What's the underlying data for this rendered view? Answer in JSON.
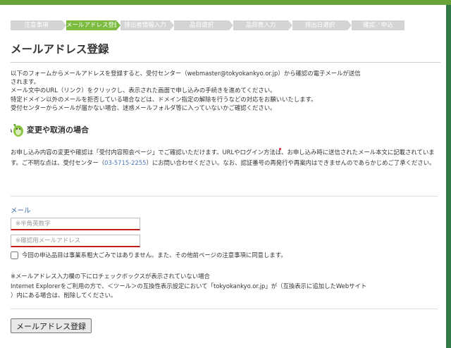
{
  "steps": [
    {
      "label": "注意事項",
      "active": false
    },
    {
      "label": "メールアドレス登録",
      "active": true
    },
    {
      "label": "排出者情報入力",
      "active": false
    },
    {
      "label": "品目選択",
      "active": false
    },
    {
      "label": "品目数入力",
      "active": false
    },
    {
      "label": "排出日選択",
      "active": false
    },
    {
      "label": "確認／申込",
      "active": false
    }
  ],
  "page": {
    "title": "メールアドレス登録"
  },
  "intro": {
    "line1": "以下のフォームからメールアドレスを登録すると、受付センター（webmaster@tokyokankyo.or.jp）から確認の電子メールが送信",
    "line2": "されます。",
    "line3": "メール文中のURL（リンク）をクリックし、表示された画面で申し込みの手続きを進めてください。",
    "line4": "特定ドメイン以外のメールを拒否している場合などは、ドメイン指定の解除を行うなどの対応をお願いいたします。",
    "line5": "受付センターからメールが届かない場合、迷惑メールフォルダ等に入っていないかご確認ください。"
  },
  "change": {
    "heading": "変更や取消の場合",
    "text_before": "お申し込み内容の変更や確認は「受付内容照会ページ」でご確認いただけます。URLやログイン方法は、お申し込み時に送信されたメール本文に記載されています。ご不明な点は、受付センター（",
    "tel": "03-5715-2255",
    "text_after": "）にお問い合わせください。なお、認証番号の再発行や再案内はできませんのであらかじめご了承ください。"
  },
  "form": {
    "mail_label": "メール",
    "email_placeholder": "※半角英数字",
    "confirm_placeholder": "※確認用メールアドレス",
    "agree_text": "今回の申込品目は事業系粗大ごみではありません。また、その他前ページの注意事項に同意します。",
    "submit_label": "メールアドレス登録"
  },
  "note": {
    "line1": "※メールアドレス入力欄の下にロチェックボックスが表示されていない場合",
    "line2": "Internet Explorerをご利用の方で、＜ツール＞の互換性表示設定において「tokyokankyo.or.jp」が（互換表示に追加したWebサイト",
    "line3": "）内にある場合は、削除してください。"
  },
  "colors": {
    "header_green": "#6aa33a",
    "active_step": "#7dbb3f",
    "inactive_step": "#d4d4d4",
    "field_underline": "#c41e1e",
    "link_blue": "#4a77b4"
  }
}
